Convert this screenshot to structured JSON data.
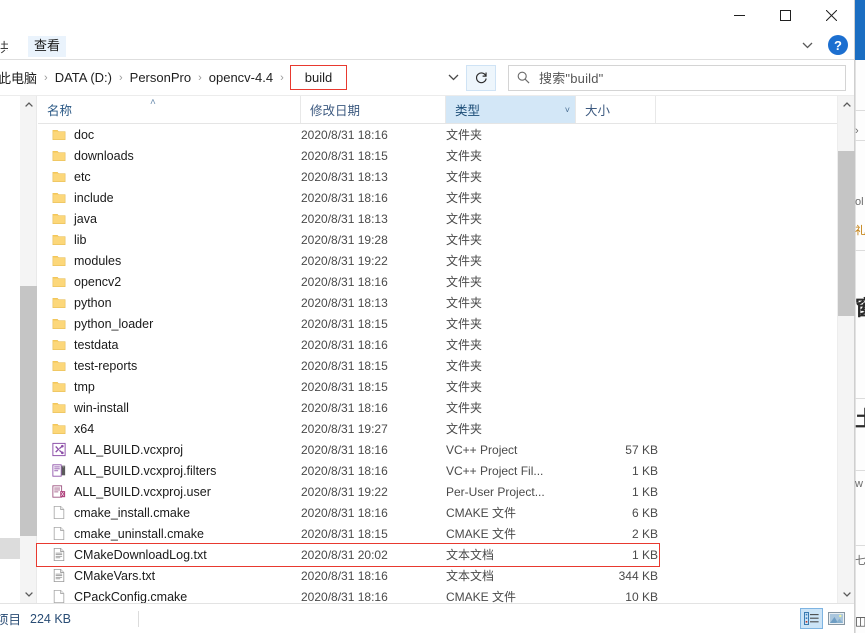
{
  "window": {
    "controls": {
      "minimize_label": "—",
      "maximize_label": "□",
      "close_label": "✕"
    }
  },
  "ribbon": {
    "cut_tab_label": "共",
    "view_tab_label": "查看",
    "help_label": "?",
    "expand_label": "˅"
  },
  "address": {
    "crumbs": [
      {
        "label": "此电脑",
        "boxed": false
      },
      {
        "label": "DATA (D:)",
        "boxed": false
      },
      {
        "label": "PersonPro",
        "boxed": false
      },
      {
        "label": "opencv-4.4",
        "boxed": false
      },
      {
        "label": "build",
        "boxed": true
      }
    ],
    "separator": "›",
    "dropdown_label": "˅",
    "refresh_label": "↻"
  },
  "search": {
    "placeholder": "搜索\"build\"",
    "icon": "search-icon"
  },
  "columns": {
    "name": "名称",
    "date_modified": "修改日期",
    "type": "类型",
    "size": "大小",
    "sort_arrow": "˄",
    "type_caret": "˅"
  },
  "files": [
    {
      "name": "doc",
      "date": "2020/8/31 18:16",
      "type": "文件夹",
      "size": "",
      "icon": "folder-icon"
    },
    {
      "name": "downloads",
      "date": "2020/8/31 18:15",
      "type": "文件夹",
      "size": "",
      "icon": "folder-icon"
    },
    {
      "name": "etc",
      "date": "2020/8/31 18:13",
      "type": "文件夹",
      "size": "",
      "icon": "folder-icon"
    },
    {
      "name": "include",
      "date": "2020/8/31 18:16",
      "type": "文件夹",
      "size": "",
      "icon": "folder-icon"
    },
    {
      "name": "java",
      "date": "2020/8/31 18:13",
      "type": "文件夹",
      "size": "",
      "icon": "folder-icon"
    },
    {
      "name": "lib",
      "date": "2020/8/31 19:28",
      "type": "文件夹",
      "size": "",
      "icon": "folder-icon"
    },
    {
      "name": "modules",
      "date": "2020/8/31 19:22",
      "type": "文件夹",
      "size": "",
      "icon": "folder-icon"
    },
    {
      "name": "opencv2",
      "date": "2020/8/31 18:16",
      "type": "文件夹",
      "size": "",
      "icon": "folder-icon"
    },
    {
      "name": "python",
      "date": "2020/8/31 18:13",
      "type": "文件夹",
      "size": "",
      "icon": "folder-icon"
    },
    {
      "name": "python_loader",
      "date": "2020/8/31 18:15",
      "type": "文件夹",
      "size": "",
      "icon": "folder-icon"
    },
    {
      "name": "testdata",
      "date": "2020/8/31 18:16",
      "type": "文件夹",
      "size": "",
      "icon": "folder-icon"
    },
    {
      "name": "test-reports",
      "date": "2020/8/31 18:15",
      "type": "文件夹",
      "size": "",
      "icon": "folder-icon"
    },
    {
      "name": "tmp",
      "date": "2020/8/31 18:15",
      "type": "文件夹",
      "size": "",
      "icon": "folder-icon"
    },
    {
      "name": "win-install",
      "date": "2020/8/31 18:16",
      "type": "文件夹",
      "size": "",
      "icon": "folder-icon"
    },
    {
      "name": "x64",
      "date": "2020/8/31 19:27",
      "type": "文件夹",
      "size": "",
      "icon": "folder-icon"
    },
    {
      "name": "ALL_BUILD.vcxproj",
      "date": "2020/8/31 18:16",
      "type": "VC++ Project",
      "size": "57 KB",
      "icon": "vcxproj-icon"
    },
    {
      "name": "ALL_BUILD.vcxproj.filters",
      "date": "2020/8/31 18:16",
      "type": "VC++ Project Fil...",
      "size": "1 KB",
      "icon": "filters-icon"
    },
    {
      "name": "ALL_BUILD.vcxproj.user",
      "date": "2020/8/31 19:22",
      "type": "Per-User Project...",
      "size": "1 KB",
      "icon": "user-proj-icon"
    },
    {
      "name": "cmake_install.cmake",
      "date": "2020/8/31 18:16",
      "type": "CMAKE 文件",
      "size": "6 KB",
      "icon": "blank-file-icon"
    },
    {
      "name": "cmake_uninstall.cmake",
      "date": "2020/8/31 18:15",
      "type": "CMAKE 文件",
      "size": "2 KB",
      "icon": "blank-file-icon"
    },
    {
      "name": "CMakeDownloadLog.txt",
      "date": "2020/8/31 20:02",
      "type": "文本文档",
      "size": "1 KB",
      "icon": "text-file-icon"
    },
    {
      "name": "CMakeVars.txt",
      "date": "2020/8/31 18:16",
      "type": "文本文档",
      "size": "344 KB",
      "icon": "text-file-icon"
    },
    {
      "name": "CPackConfig.cmake",
      "date": "2020/8/31 18:16",
      "type": "CMAKE 文件",
      "size": "10 KB",
      "icon": "blank-file-icon"
    }
  ],
  "annotation": {
    "highlighted_row_name": "CMakeDownloadLog.txt",
    "box_color": "#e8392f"
  },
  "status": {
    "items_text": "项目",
    "size_text": "224 KB"
  },
  "view_toggle": {
    "details_view": "details-view-icon",
    "large_icons_view": "large-icons-view-icon"
  },
  "background": {
    "glyph_1": "ol",
    "glyph_2": "礼",
    "glyph_3": "窗",
    "glyph_4": "土",
    "glyph_5": "w",
    "glyph_6": "七"
  },
  "colors": {
    "accent": "#1c6fd0",
    "annotation_red": "#e8392f",
    "column_highlight": "#d3e7f7",
    "folder_yellow": "#fcd77a"
  }
}
